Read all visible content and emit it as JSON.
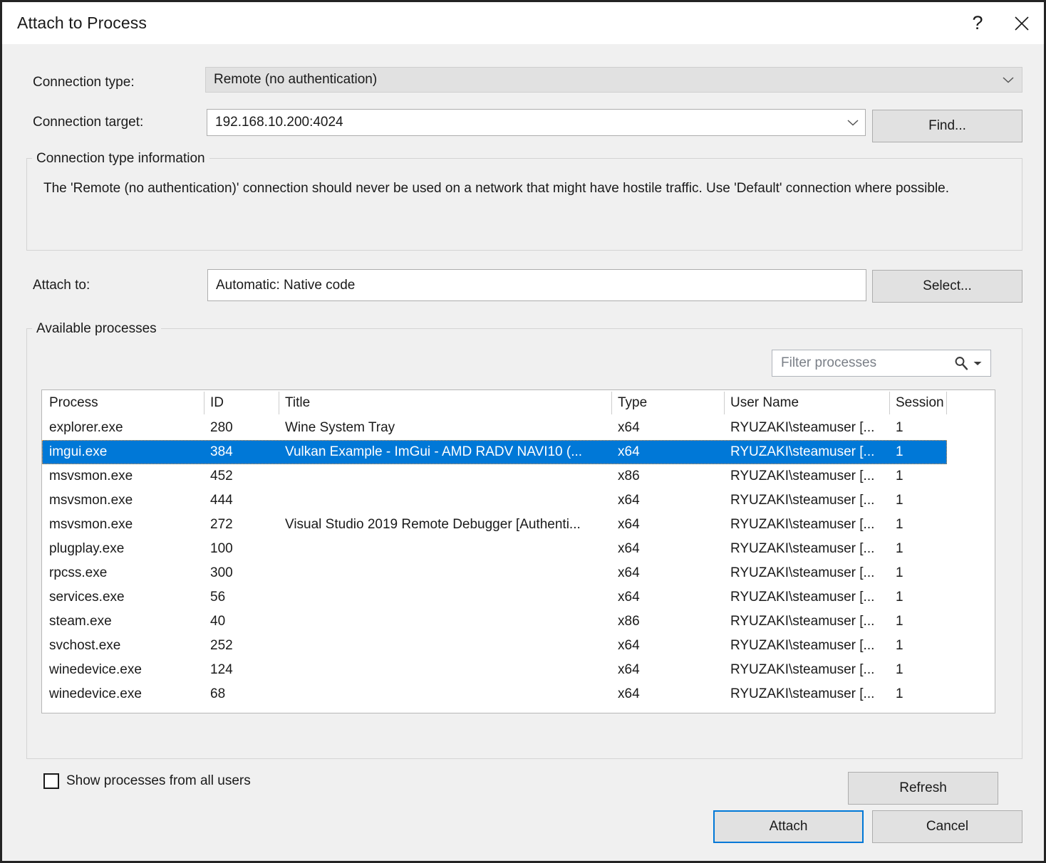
{
  "window": {
    "title": "Attach to Process",
    "help_icon": "question-mark-icon",
    "close_icon": "close-icon"
  },
  "connection": {
    "type_label": "Connection type:",
    "type_value": "Remote (no authentication)",
    "target_label": "Connection target:",
    "target_value": "192.168.10.200:4024",
    "find_button": "Find...",
    "info_group_title": "Connection type information",
    "info_text": "The 'Remote (no authentication)' connection should never be used on a network that might have hostile traffic. Use 'Default' connection where possible."
  },
  "attach_to": {
    "label": "Attach to:",
    "value": "Automatic: Native code",
    "select_button": "Select..."
  },
  "processes": {
    "group_title": "Available processes",
    "filter_placeholder": "Filter processes",
    "filter_value": "",
    "search_icon": "search-icon",
    "dropdown_icon": "chevron-down-icon",
    "columns": [
      "Process",
      "ID",
      "Title",
      "Type",
      "User Name",
      "Session"
    ],
    "rows": [
      {
        "process": "explorer.exe",
        "id": "280",
        "title": "Wine System Tray",
        "type": "x64",
        "user": "RYUZAKI\\steamuser [...",
        "session": "1",
        "selected": false
      },
      {
        "process": "imgui.exe",
        "id": "384",
        "title": "Vulkan Example - ImGui - AMD RADV NAVI10 (...",
        "type": "x64",
        "user": "RYUZAKI\\steamuser [...",
        "session": "1",
        "selected": true
      },
      {
        "process": "msvsmon.exe",
        "id": "452",
        "title": "",
        "type": "x86",
        "user": "RYUZAKI\\steamuser [...",
        "session": "1",
        "selected": false
      },
      {
        "process": "msvsmon.exe",
        "id": "444",
        "title": "",
        "type": "x64",
        "user": "RYUZAKI\\steamuser [...",
        "session": "1",
        "selected": false
      },
      {
        "process": "msvsmon.exe",
        "id": "272",
        "title": "Visual Studio 2019 Remote Debugger [Authenti...",
        "type": "x64",
        "user": "RYUZAKI\\steamuser [...",
        "session": "1",
        "selected": false
      },
      {
        "process": "plugplay.exe",
        "id": "100",
        "title": "",
        "type": "x64",
        "user": "RYUZAKI\\steamuser [...",
        "session": "1",
        "selected": false
      },
      {
        "process": "rpcss.exe",
        "id": "300",
        "title": "",
        "type": "x64",
        "user": "RYUZAKI\\steamuser [...",
        "session": "1",
        "selected": false
      },
      {
        "process": "services.exe",
        "id": "56",
        "title": "",
        "type": "x64",
        "user": "RYUZAKI\\steamuser [...",
        "session": "1",
        "selected": false
      },
      {
        "process": "steam.exe",
        "id": "40",
        "title": "",
        "type": "x86",
        "user": "RYUZAKI\\steamuser [...",
        "session": "1",
        "selected": false
      },
      {
        "process": "svchost.exe",
        "id": "252",
        "title": "",
        "type": "x64",
        "user": "RYUZAKI\\steamuser [...",
        "session": "1",
        "selected": false
      },
      {
        "process": "winedevice.exe",
        "id": "124",
        "title": "",
        "type": "x64",
        "user": "RYUZAKI\\steamuser [...",
        "session": "1",
        "selected": false
      },
      {
        "process": "winedevice.exe",
        "id": "68",
        "title": "",
        "type": "x64",
        "user": "RYUZAKI\\steamuser [...",
        "session": "1",
        "selected": false
      }
    ],
    "show_all_users_label": "Show processes from all users",
    "show_all_users_checked": false,
    "refresh_button": "Refresh"
  },
  "footer": {
    "attach_button": "Attach",
    "cancel_button": "Cancel"
  },
  "colors": {
    "selection": "#0078d7",
    "dialog_bg": "#f0f0f0",
    "button_face": "#e1e1e1"
  }
}
